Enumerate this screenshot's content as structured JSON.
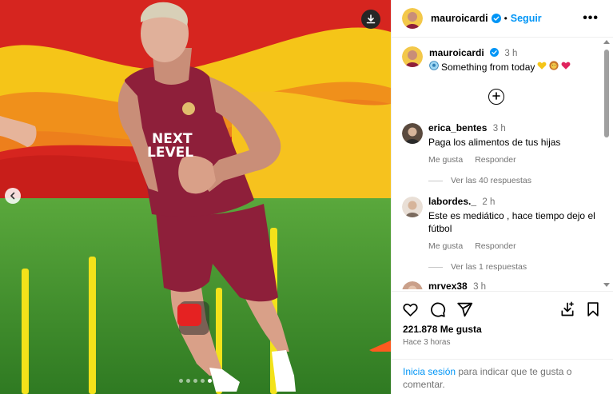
{
  "post": {
    "author": "mauroicardi",
    "follow_label": "Seguir",
    "separator": "•",
    "more_label": "•••"
  },
  "caption": {
    "author": "mauroicardi",
    "time": "3 h",
    "text": "Something from today"
  },
  "comments": [
    {
      "author": "erica_bentes",
      "time": "3 h",
      "text": "Paga los alimentos de tus hijas",
      "like_label": "Me gusta",
      "reply_label": "Responder",
      "replies_label": "Ver las 40 respuestas"
    },
    {
      "author": "labordes._",
      "time": "2 h",
      "text": "Este es mediático , hace tiempo dejo el fútbol",
      "like_label": "Me gusta",
      "reply_label": "Responder",
      "replies_label": "Ver las 1 respuestas"
    },
    {
      "author": "mrvex38",
      "time": "3 h"
    }
  ],
  "jersey_text": [
    "NEXT",
    "LEVEL"
  ],
  "stats": {
    "likes": "221.878 Me gusta",
    "posted": "Hace 3 horas"
  },
  "login_prompt": {
    "link": "Inicia sesión",
    "text": " para indicar que te gusta o comentar."
  },
  "carousel": {
    "count": 5,
    "active": 4
  },
  "colors": {
    "link_blue": "#0095f6",
    "verified_blue": "#0095f6",
    "jersey": "#8e1f3a",
    "background_red": "#d6251f",
    "background_yellow": "#f5c518",
    "grass": "#3f8a2a",
    "heart_red": "#e0245e"
  },
  "icons": [
    "download-icon",
    "chevron-left-icon",
    "verified-badge-icon",
    "more-options-icon",
    "add-comment-icon",
    "heart-icon",
    "comment-icon",
    "share-icon",
    "save-to-collection-icon",
    "bookmark-icon"
  ]
}
